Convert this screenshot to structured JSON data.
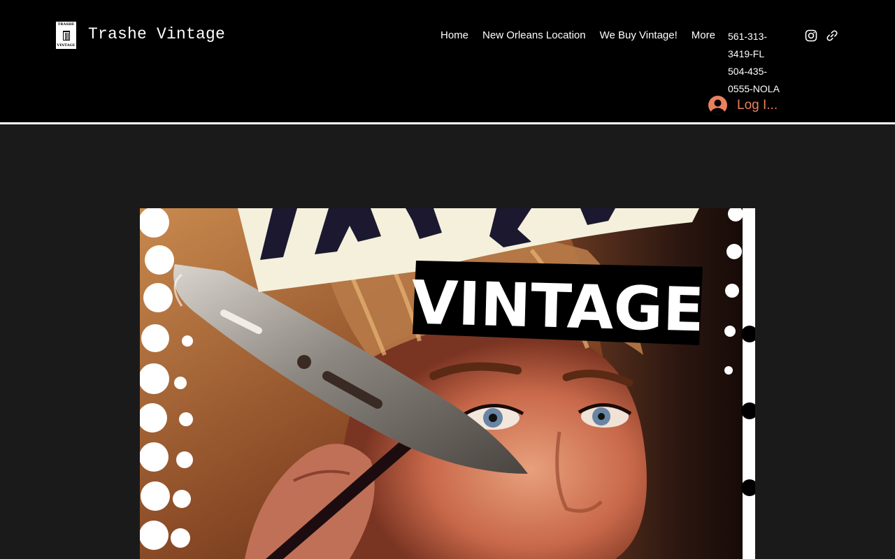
{
  "site": {
    "title": "Trashe Vintage",
    "logo_text_top": "TRASHÉ",
    "logo_text_bottom": "VINTAGE"
  },
  "nav": {
    "items": [
      {
        "label": "Home"
      },
      {
        "label": "New Orleans Location"
      },
      {
        "label": "We Buy Vintage!"
      },
      {
        "label": "More"
      }
    ]
  },
  "contact": {
    "phone_fl_line1": "561-313-",
    "phone_fl_line2": "3419-FL",
    "phone_nola_line1": "504-435-",
    "phone_nola_line2": "0555-NOLA"
  },
  "social": {
    "icons": [
      "instagram-icon",
      "link-icon"
    ]
  },
  "login": {
    "label": "Log I..."
  },
  "hero": {
    "sign_text": "VINTAGE",
    "banner_text": "TRASHE",
    "colors": {
      "sign_bg": "#000000",
      "sign_text": "#ffffff",
      "banner_bg": "#f4f0dc",
      "accent": "#e9805f"
    }
  },
  "theme": {
    "header_bg": "#000000",
    "page_bg": "#1a1a1a",
    "nav_text": "#ffffff",
    "login_color": "#e9805f"
  }
}
